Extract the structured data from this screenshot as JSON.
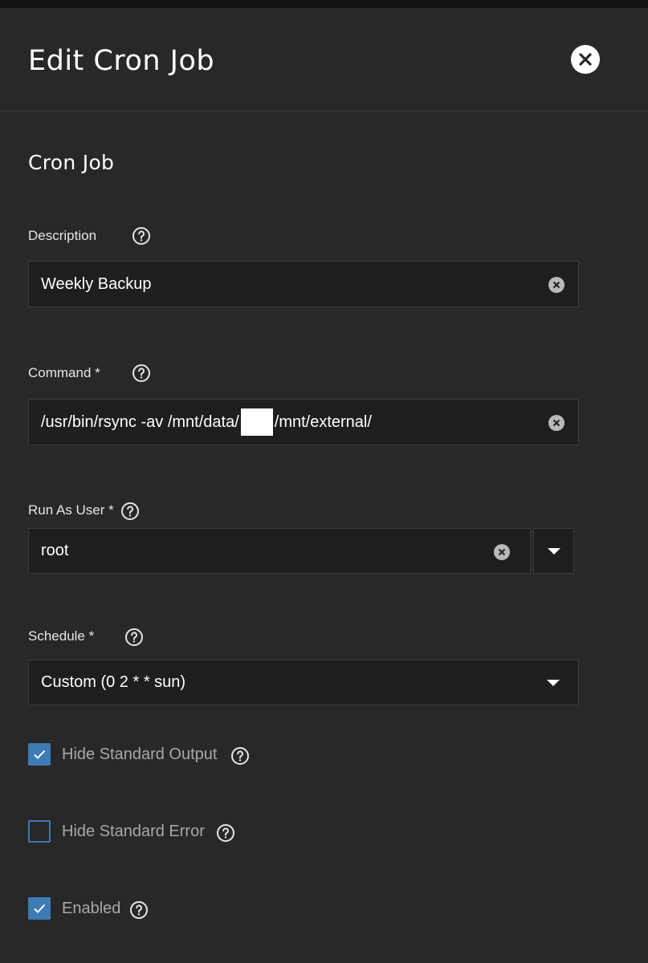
{
  "header": {
    "title": "Edit Cron Job"
  },
  "section": {
    "title": "Cron Job"
  },
  "description": {
    "label": "Description",
    "value": "Weekly Backup"
  },
  "command": {
    "label": "Command *",
    "value_before": "/usr/bin/rsync -av /mnt/data/",
    "value_after": "/mnt/external/"
  },
  "run_as_user": {
    "label": "Run As User *",
    "value": "root"
  },
  "schedule": {
    "label": "Schedule *",
    "value": "Custom (0 2 * * sun)"
  },
  "checkboxes": {
    "hide_stdout": {
      "label": "Hide Standard Output",
      "checked": true
    },
    "hide_stderr": {
      "label": "Hide Standard Error",
      "checked": false
    },
    "enabled": {
      "label": "Enabled",
      "checked": true
    }
  },
  "colors": {
    "background": "#282828",
    "field": "#1e1e1e",
    "accent": "#3d7bb5"
  }
}
